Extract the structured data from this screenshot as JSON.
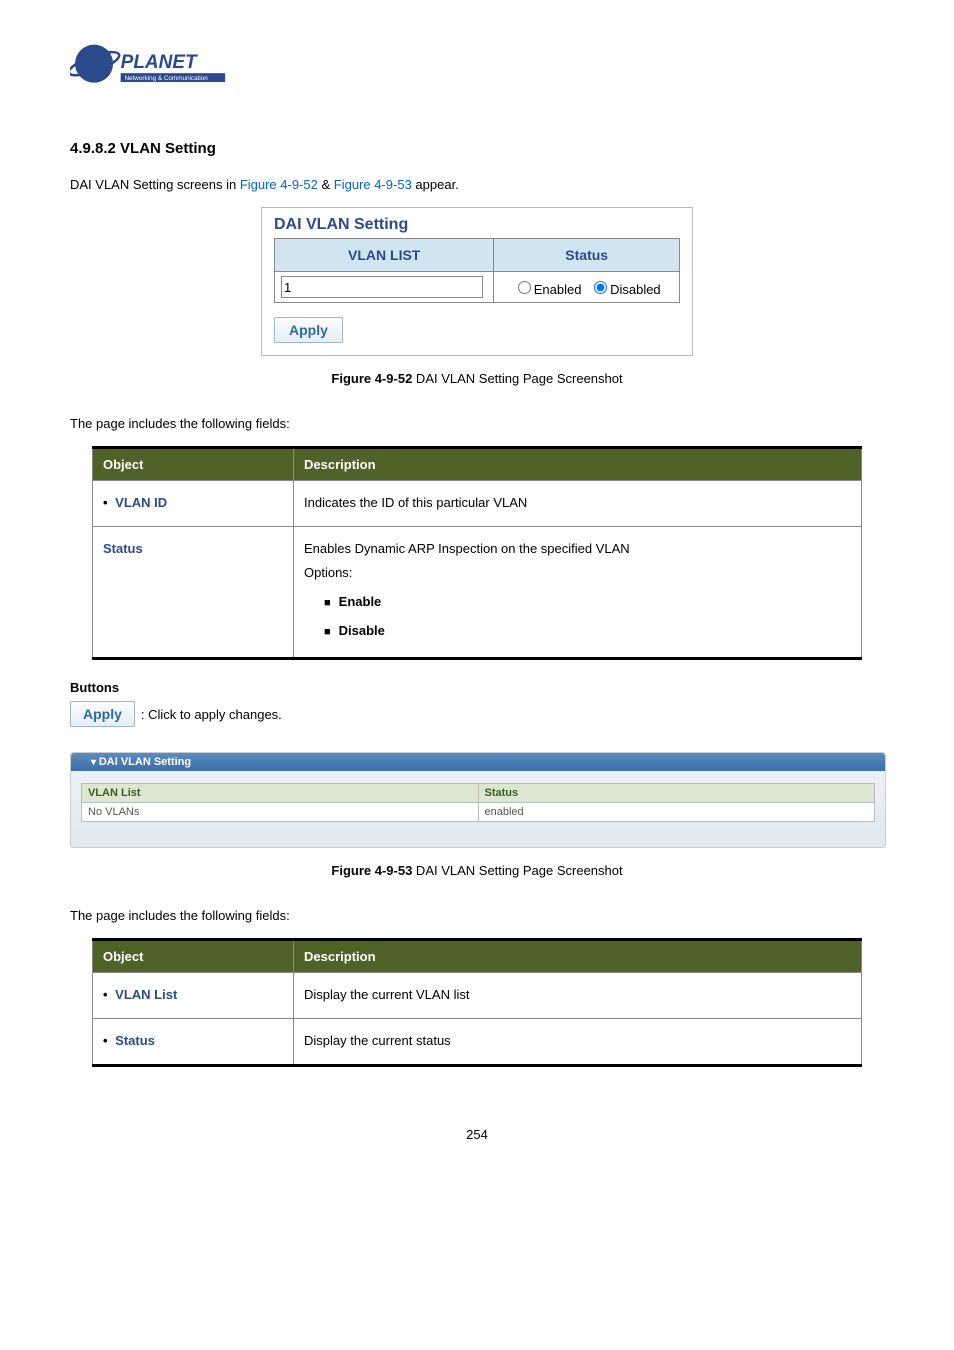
{
  "logo": {
    "brand": "PLANET",
    "tagline": "Networking & Communication"
  },
  "section_title": "4.9.8.2 VLAN Setting",
  "intro": {
    "prefix": "DAI VLAN Setting screens in ",
    "link1": "Figure 4-9-52",
    "amp": " & ",
    "link2": "Figure 4-9-53",
    "suffix": " appear."
  },
  "ss1": {
    "title": "DAI VLAN Setting",
    "col1": "VLAN LIST",
    "col2": "Status",
    "input_value": "1",
    "radio_enabled": "Enabled",
    "radio_disabled": "Disabled",
    "apply": "Apply"
  },
  "fig1": {
    "label": "Figure 4-9-52",
    "caption": " DAI VLAN Setting Page Screenshot"
  },
  "fields_intro": "The page includes the following fields:",
  "od1": {
    "h1": "Object",
    "h2": "Description",
    "r1_obj": "VLAN ID",
    "r1_desc": "Indicates the ID of this particular VLAN",
    "r2_obj": "Status",
    "r2_desc_line1": "Enables Dynamic ARP Inspection on the specified VLAN",
    "r2_desc_line2": "Options:",
    "r2_opt1": "Enable",
    "r2_opt2": "Disable"
  },
  "buttons": {
    "heading": "Buttons",
    "apply": "Apply",
    "desc": ": Click to apply changes."
  },
  "ss2": {
    "header": "DAI VLAN Setting",
    "col1": "VLAN List",
    "col2": "Status",
    "cell1": "No VLANs",
    "cell2": "enabled"
  },
  "fig2": {
    "label": "Figure 4-9-53",
    "caption": " DAI VLAN Setting Page Screenshot"
  },
  "od2": {
    "h1": "Object",
    "h2": "Description",
    "r1_obj": "VLAN List",
    "r1_desc": "Display the current VLAN list",
    "r2_obj": "Status",
    "r2_desc": "Display the current status"
  },
  "page_number": "254"
}
